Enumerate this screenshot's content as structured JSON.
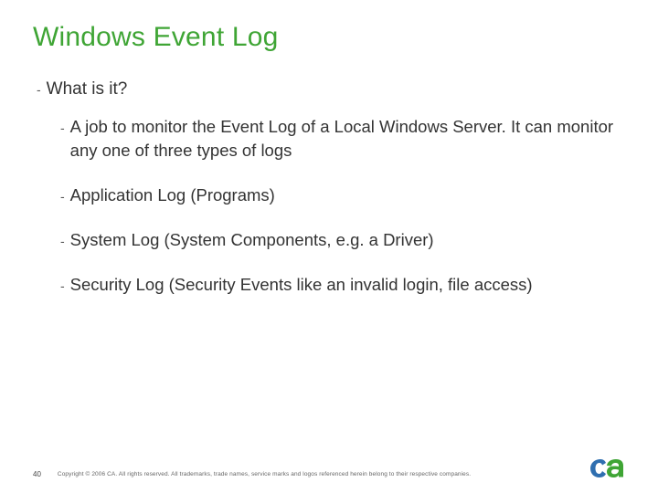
{
  "slide": {
    "title": "Windows Event Log",
    "bullets_lvl1": [
      {
        "text": "What is it?"
      }
    ],
    "bullets_lvl2": [
      {
        "text": "A job to monitor the Event Log of a Local Windows Server. It can monitor any one of three types of logs"
      },
      {
        "text": "Application Log (Programs)"
      },
      {
        "text": "System Log (System Components, e.g. a Driver)"
      },
      {
        "text": "Security Log (Security Events like an invalid login, file access)"
      }
    ],
    "dash": "-"
  },
  "footer": {
    "page_number": "40",
    "copyright": "Copyright © 2006 CA. All rights reserved. All trademarks, trade names, service marks and logos referenced herein belong to their respective companies."
  },
  "brand": {
    "logo_name": "ca-logo",
    "colors": {
      "c": "#2f6fb0",
      "a": "#3fa535"
    }
  }
}
